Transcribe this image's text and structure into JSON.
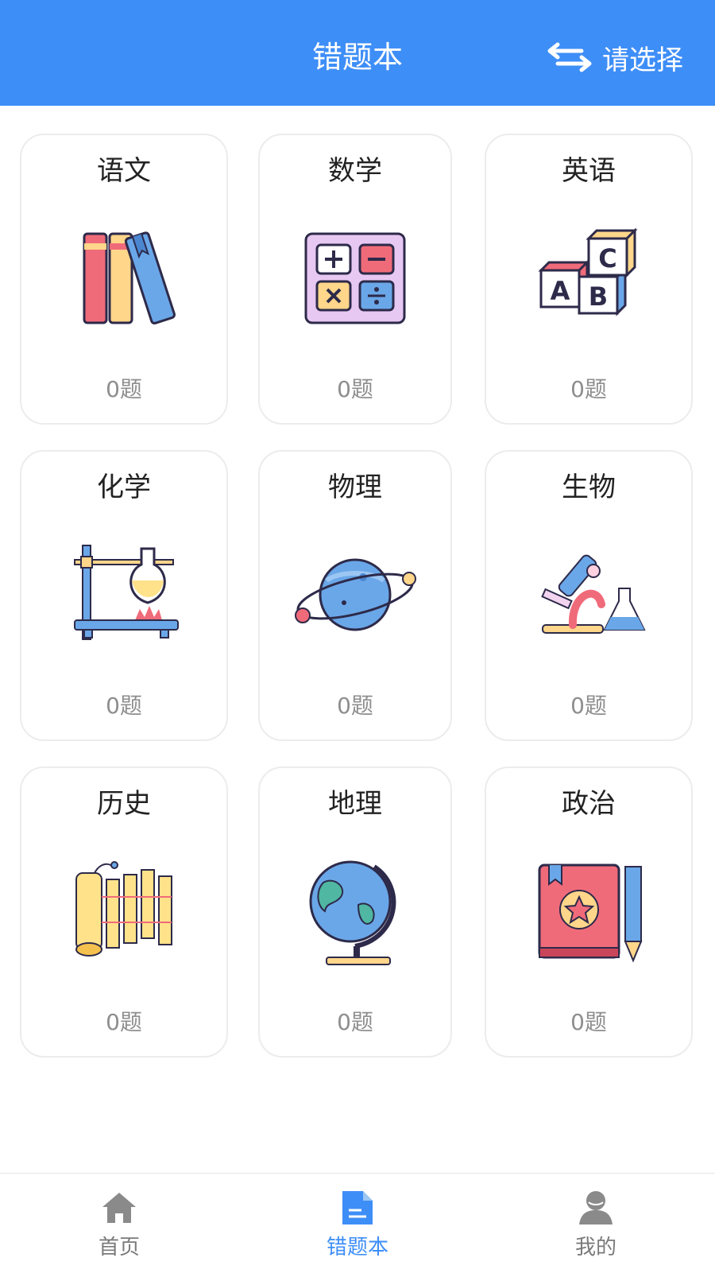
{
  "header": {
    "title": "错题本",
    "switch_label": "请选择"
  },
  "subjects": [
    {
      "name": "语文",
      "count": "0题",
      "icon": "books-icon"
    },
    {
      "name": "数学",
      "count": "0题",
      "icon": "calculator-icon"
    },
    {
      "name": "英语",
      "count": "0题",
      "icon": "abc-blocks-icon"
    },
    {
      "name": "化学",
      "count": "0题",
      "icon": "flask-burner-icon"
    },
    {
      "name": "物理",
      "count": "0题",
      "icon": "planet-icon"
    },
    {
      "name": "生物",
      "count": "0题",
      "icon": "microscope-icon"
    },
    {
      "name": "历史",
      "count": "0题",
      "icon": "bamboo-scroll-icon"
    },
    {
      "name": "地理",
      "count": "0题",
      "icon": "globe-icon"
    },
    {
      "name": "政治",
      "count": "0题",
      "icon": "book-star-icon"
    }
  ],
  "tabbar": [
    {
      "label": "首页",
      "icon": "home-icon",
      "active": false
    },
    {
      "label": "错题本",
      "icon": "document-icon",
      "active": true
    },
    {
      "label": "我的",
      "icon": "user-icon",
      "active": false
    }
  ],
  "colors": {
    "accent": "#3e8ef7",
    "muted": "#8e8e8e"
  }
}
